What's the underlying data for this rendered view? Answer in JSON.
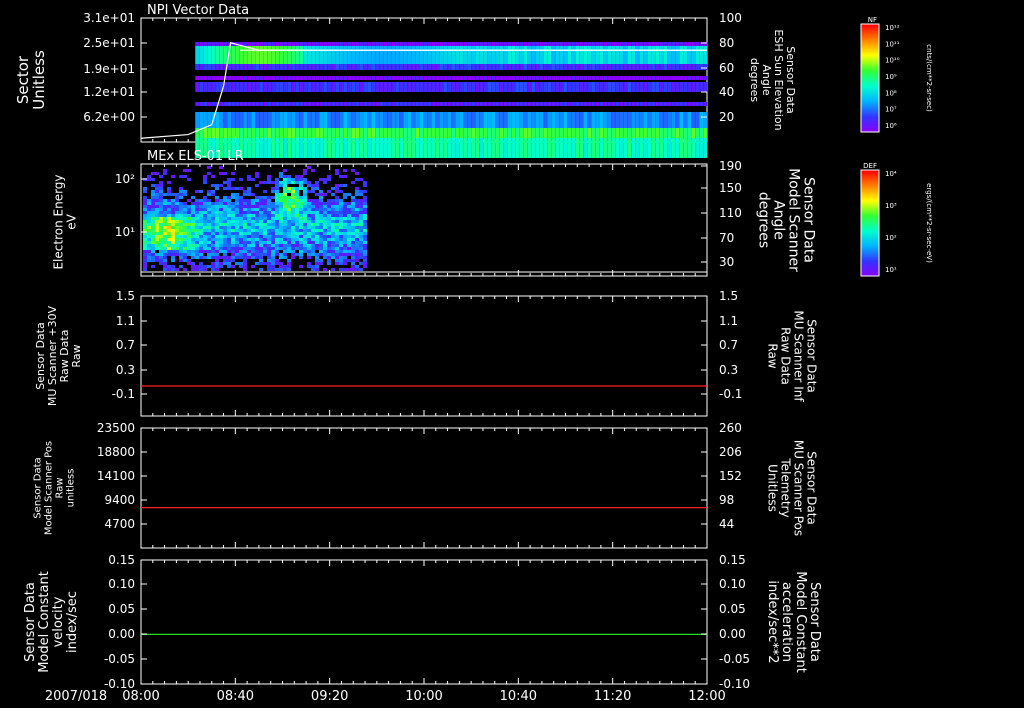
{
  "colors": {
    "red": "#ff2020",
    "green": "#22dd22",
    "white": "#ffffff"
  },
  "chart_data": [
    {
      "type": "heatmap",
      "title": "NPI Vector Data",
      "ylabel": [
        "Sector",
        "Unitless"
      ],
      "yticks": [
        "3.1e+01",
        "2.5e+01",
        "1.9e+01",
        "1.2e+01",
        "6.2e+00"
      ],
      "ylabel_right": [
        "Sensor Data",
        "ESH Sun Elevation",
        "Angle",
        "degrees"
      ],
      "yticks_right": [
        "100",
        "80",
        "60",
        "40",
        "20"
      ],
      "colorbar": {
        "label": "NF",
        "unit": "cnts/(cm**2-sr-sec)",
        "ticks": [
          "10¹²",
          "10¹¹",
          "10¹⁰",
          "10⁹",
          "10⁸",
          "10⁷",
          "10⁶"
        ]
      },
      "overlay_series": {
        "x": [
          "08:00",
          "08:20",
          "08:30",
          "08:35",
          "08:38",
          "08:42",
          "08:50",
          "09:20",
          "10:00",
          "12:00"
        ],
        "y": [
          3,
          6,
          14,
          45,
          80,
          78,
          74,
          74,
          74,
          74
        ]
      }
    },
    {
      "type": "heatmap",
      "title": "MEx ELS-01 LR",
      "ylabel": [
        "Electron Energy",
        "eV"
      ],
      "yticks": [
        "10²",
        "10¹"
      ],
      "ylabel_right": [
        "Sensor Data",
        "Model Scanner",
        "Angle",
        "degrees"
      ],
      "yticks_right": [
        "190",
        "150",
        "110",
        "70",
        "30"
      ],
      "colorbar": {
        "label": "DEF",
        "unit": "ergs/(cm**2-sr-sec-eV)",
        "ticks": [
          "10⁴",
          "10³",
          "10²",
          "10¹"
        ]
      },
      "overlay_series": {
        "y": 15
      }
    },
    {
      "type": "line",
      "ylabel": [
        "Sensor Data",
        "MU Scanner +30V",
        "Raw Data",
        "Raw"
      ],
      "yticks": [
        "1.5",
        "1.1",
        "0.7",
        "0.3",
        "-0.1"
      ],
      "ylim": [
        -0.5,
        1.5
      ],
      "ylabel_right": [
        "Sensor Data",
        "MU Scanner Inf",
        "Raw Data",
        "Raw"
      ],
      "yticks_right": [
        "1.5",
        "1.1",
        "0.7",
        "0.3",
        "-0.1"
      ],
      "series": [
        {
          "color": "#ff2020",
          "x": [
            "08:00",
            "12:00"
          ],
          "y": [
            0.0,
            0.0
          ]
        }
      ]
    },
    {
      "type": "line",
      "ylabel": [
        "Sensor Data",
        "Model Scanner Pos",
        "Raw",
        "unitless"
      ],
      "yticks": [
        "23500",
        "18800",
        "14100",
        "9400",
        "4700"
      ],
      "ylim": [
        0,
        23500
      ],
      "ylabel_right": [
        "Sensor Data",
        "MU Scanner Pos",
        "Telemetry",
        "Unitless"
      ],
      "yticks_right": [
        "260",
        "206",
        "152",
        "98",
        "44"
      ],
      "series": [
        {
          "color": "#ff2020",
          "x": [
            "08:00",
            "12:00"
          ],
          "y": [
            7900,
            7900
          ]
        }
      ]
    },
    {
      "type": "line",
      "ylabel": [
        "Sensor Data",
        "Model Constant",
        "velocity",
        "index/sec"
      ],
      "yticks": [
        "0.15",
        "0.10",
        "0.05",
        "0.00",
        "-0.05",
        "-0.10"
      ],
      "ylim": [
        -0.1,
        0.15
      ],
      "ylabel_right": [
        "Sensor Data",
        "Model Constant",
        "acceleration",
        "index/sec**2"
      ],
      "yticks_right": [
        "0.15",
        "0.10",
        "0.05",
        "0.00",
        "-0.05",
        "-0.10"
      ],
      "series": [
        {
          "color": "#22dd22",
          "x": [
            "08:00",
            "12:00"
          ],
          "y": [
            0.0,
            0.0
          ]
        }
      ]
    }
  ],
  "x_axis": {
    "date": "2007/018",
    "ticks": [
      "08:00",
      "08:40",
      "09:20",
      "10:00",
      "10:40",
      "11:20",
      "12:00"
    ]
  }
}
